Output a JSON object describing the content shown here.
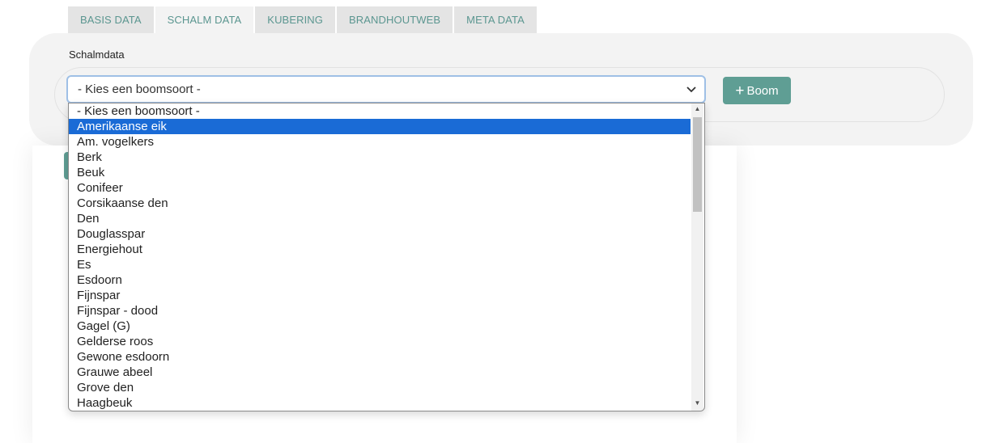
{
  "tabs": [
    {
      "label": "BASIS DATA",
      "active": false
    },
    {
      "label": "SCHALM DATA",
      "active": true
    },
    {
      "label": "KUBERING",
      "active": false
    },
    {
      "label": "BRANDHOUTWEB",
      "active": false
    },
    {
      "label": "META DATA",
      "active": false
    }
  ],
  "section": {
    "title": "Schalmdata"
  },
  "select": {
    "value": "- Kies een boomsoort -",
    "chevron": "chevron-down-icon"
  },
  "add_button": {
    "icon": "plus-icon",
    "label": "Boom"
  },
  "dropdown": {
    "selected_index": 1,
    "options": [
      "- Kies een boomsoort -",
      "Amerikaanse eik",
      "Am. vogelkers",
      "Berk",
      "Beuk",
      "Conifeer",
      "Corsikaanse den",
      "Den",
      "Douglasspar",
      "Energiehout",
      "Es",
      "Esdoorn",
      "Fijnspar",
      "Fijnspar - dood",
      "Gagel (G)",
      "Gelderse roos",
      "Gewone esdoorn",
      "Grauwe abeel",
      "Grove den",
      "Haagbeuk"
    ]
  },
  "colors": {
    "accent": "#5f9e94",
    "highlight": "#1a6bd6",
    "tab_text": "#5b9690"
  }
}
